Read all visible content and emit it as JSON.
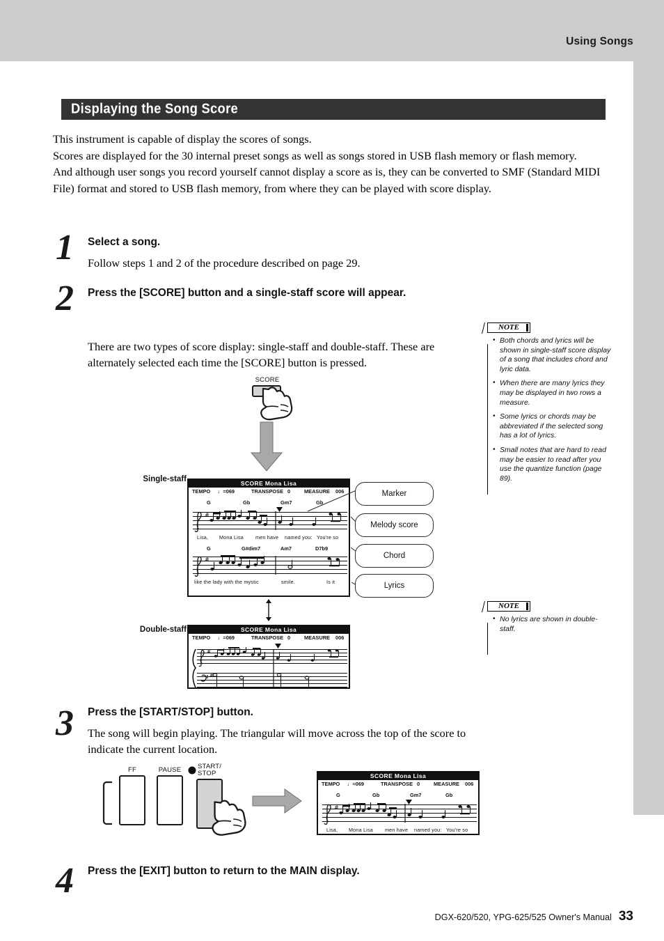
{
  "header": {
    "running_head": "Using Songs"
  },
  "section": {
    "title": "Displaying the Song Score"
  },
  "intro": "This instrument is capable of display the scores of songs.\nScores are displayed for the 30 internal preset songs as well as songs stored in USB flash memory or flash memory.\nAnd although user songs you record yourself cannot display a score as is, they can be converted to SMF (Standard MIDI File) format and stored to USB flash memory, from where they can be played with score display.",
  "steps": [
    {
      "number": "1",
      "heading": "Select a song.",
      "body": "Follow steps 1 and 2 of the procedure described on page 29."
    },
    {
      "number": "2",
      "heading": "Press the [SCORE] button and a single-staff score will appear.",
      "body": "There are two types of score display: single-staff and double-staff. These are alternately selected each time the [SCORE] button is pressed."
    },
    {
      "number": "3",
      "heading": "Press the [START/STOP] button.",
      "body": "The song will begin playing. The triangular will move across the top of the score to indicate the current location."
    },
    {
      "number": "4",
      "heading": "Press the [EXIT] button to return to the MAIN display.",
      "body": ""
    }
  ],
  "notes": [
    {
      "label": "NOTE",
      "items": [
        "Both chords and lyrics will be shown in single-staff score display of a song that includes chord and lyric data.",
        "When there are many lyrics they may be displayed in two rows a measure.",
        "Some lyrics or chords may be abbreviated if the selected song has a lot of lyrics.",
        "Small notes that are hard to read may be easier to read after you use the quantize function (page 89)."
      ]
    },
    {
      "label": "NOTE",
      "items": [
        "No lyrics are shown in double-staff."
      ]
    }
  ],
  "figure_score": {
    "score_button_label": "SCORE",
    "single_staff_label": "Single-staff",
    "double_staff_label": "Double-staff",
    "callouts": [
      "Marker",
      "Melody score",
      "Chord",
      "Lyrics"
    ],
    "lcd": {
      "title": "SCORE  Mona Lisa",
      "tempo_label": "TEMPO",
      "tempo_value": "♩=069",
      "transpose_label": "TRANSPOSE",
      "transpose_value": "0",
      "measure_label": "MEASURE",
      "measure_value": "006",
      "row1_chords": [
        "G",
        "Gb",
        "Gm7",
        "Gb"
      ],
      "row1_lyrics": [
        "Lisa,",
        "Mona Lisa",
        "men have",
        "named you:",
        "You're so"
      ],
      "row2_chords": [
        "G",
        "G#dim7",
        "Am7",
        "D7b9"
      ],
      "row2_lyrics": [
        "like the lady with the mystic",
        "smile.",
        "Is it"
      ]
    }
  },
  "figure_transport": {
    "buttons": [
      {
        "name": "FF"
      },
      {
        "name": "PAUSE"
      },
      {
        "name": "START/\nSTOP"
      }
    ],
    "start_stop_line1": "START/",
    "start_stop_line2": "STOP"
  },
  "footer": {
    "manual": "DGX-620/520, YPG-625/525  Owner's Manual",
    "page": "33"
  },
  "colors": {
    "page_background": "#cccccc",
    "sheet": "#ffffff",
    "section_bar": "#333333",
    "ink": "#111111",
    "button_face": "#d4d4d4",
    "arrow_gray": "#a8a8a8"
  }
}
